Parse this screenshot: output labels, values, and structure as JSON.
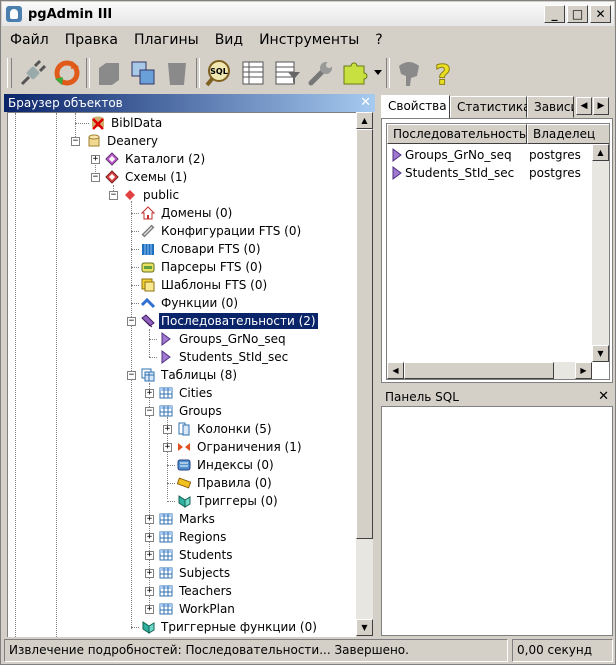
{
  "window": {
    "title": "pgAdmin III",
    "minimize": "_",
    "maximize": "□",
    "close": "✕"
  },
  "menu": [
    "Файл",
    "Правка",
    "Плагины",
    "Вид",
    "Инструменты",
    "?"
  ],
  "browser": {
    "title": "Браузер объектов",
    "close": "✕",
    "nodes": {
      "bibldata": "BiblData",
      "deanery": "Deanery",
      "catalogs": "Каталоги (2)",
      "schemas": "Схемы (1)",
      "public": "public",
      "domains": "Домены (0)",
      "fts_configs": "Конфигурации FTS (0)",
      "fts_dicts": "Словари FTS (0)",
      "fts_parsers": "Парсеры FTS (0)",
      "fts_templates": "Шаблоны FTS (0)",
      "functions": "Функции (0)",
      "sequences": "Последовательности (2)",
      "seq_groups": "Groups_GrNo_seq",
      "seq_students": "Students_StId_sec",
      "tables": "Таблицы (8)",
      "t_cities": "Cities",
      "t_groups": "Groups",
      "columns": "Колонки (5)",
      "constraints": "Ограничения (1)",
      "indexes": "Индексы (0)",
      "rules": "Правила (0)",
      "triggers": "Триггеры (0)",
      "t_marks": "Marks",
      "t_regions": "Regions",
      "t_students": "Students",
      "t_subjects": "Subjects",
      "t_teachers": "Teachers",
      "t_workplan": "WorkPlan",
      "trigger_functions": "Триггерные функции (0)"
    }
  },
  "properties": {
    "tabs": [
      "Свойства",
      "Статистика",
      "Зависи"
    ],
    "columns": [
      "Последовательность",
      "Владелец"
    ],
    "rows": [
      {
        "name": "Groups_GrNo_seq",
        "owner": "postgres"
      },
      {
        "name": "Students_StId_sec",
        "owner": "postgres"
      }
    ]
  },
  "sql_panel": {
    "title": "Панель SQL",
    "close": "✕"
  },
  "status": {
    "message": "Извлечение подробностей: Последовательности... Завершено.",
    "time": "0,00 секунд"
  }
}
